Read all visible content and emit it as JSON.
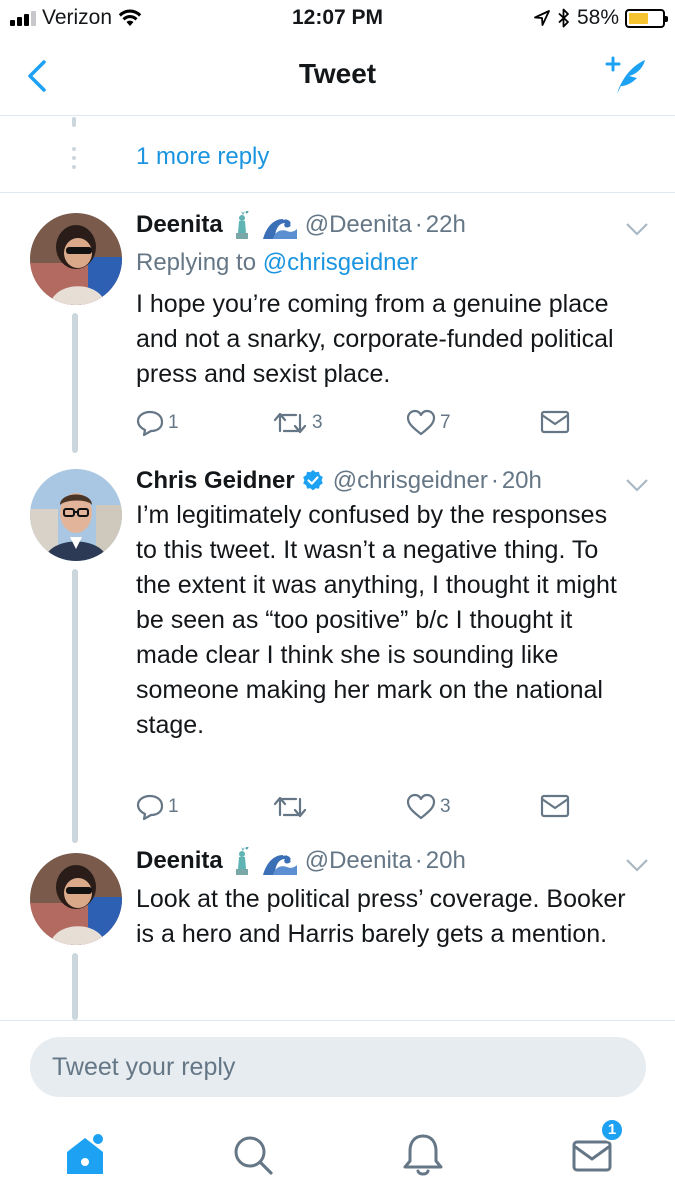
{
  "status_bar": {
    "carrier": "Verizon",
    "time": "12:07 PM",
    "battery_percent": "58%",
    "battery_level": 0.58,
    "battery_color": "#f6c430",
    "icons": [
      "signal-icon",
      "wifi-icon",
      "location-icon",
      "bluetooth-icon",
      "battery-icon"
    ]
  },
  "nav": {
    "title": "Tweet",
    "back_icon": "chevron-left-icon",
    "compose_icon": "compose-tweet-icon"
  },
  "thread": {
    "more_replies_label": "1 more reply"
  },
  "tweets": [
    {
      "name": "Deenita",
      "emoji": [
        "statue-of-liberty",
        "water-wave"
      ],
      "handle": "@Deenita",
      "separator": "·",
      "time": "22h",
      "replying_prefix": "Replying to",
      "replying_to": "@chrisgeidner",
      "text": "I hope you’re coming from a genuine place and not a snarky, corporate-funded political press and sexist place.",
      "replies": "1",
      "retweets": "3",
      "likes": "7"
    },
    {
      "name": "Chris Geidner",
      "verified": true,
      "handle": "@chrisgeidner",
      "separator": "·",
      "time": "20h",
      "text": "I’m legitimately confused by the responses to this tweet. It wasn’t a negative thing. To the extent it was anything, I thought it might be seen as “too positive” b/c I thought it made clear I think she is sounding like someone making her mark on the national stage.",
      "replies": "1",
      "retweets": "",
      "likes": "3"
    },
    {
      "name": "Deenita",
      "emoji": [
        "statue-of-liberty",
        "water-wave"
      ],
      "handle": "@Deenita",
      "separator": "·",
      "time": "20h",
      "text": "Look at the political press’ coverage. Booker is a hero and Harris barely gets a mention."
    }
  ],
  "reply_box": {
    "placeholder": "Tweet your reply"
  },
  "tab_bar": {
    "items": [
      "home-icon",
      "search-icon",
      "notifications-icon",
      "messages-icon"
    ],
    "messages_badge": "1"
  },
  "colors": {
    "accent": "#1da1f2",
    "link": "#1b95e0",
    "secondary_text": "#657786",
    "divider": "#e1e8ed"
  }
}
